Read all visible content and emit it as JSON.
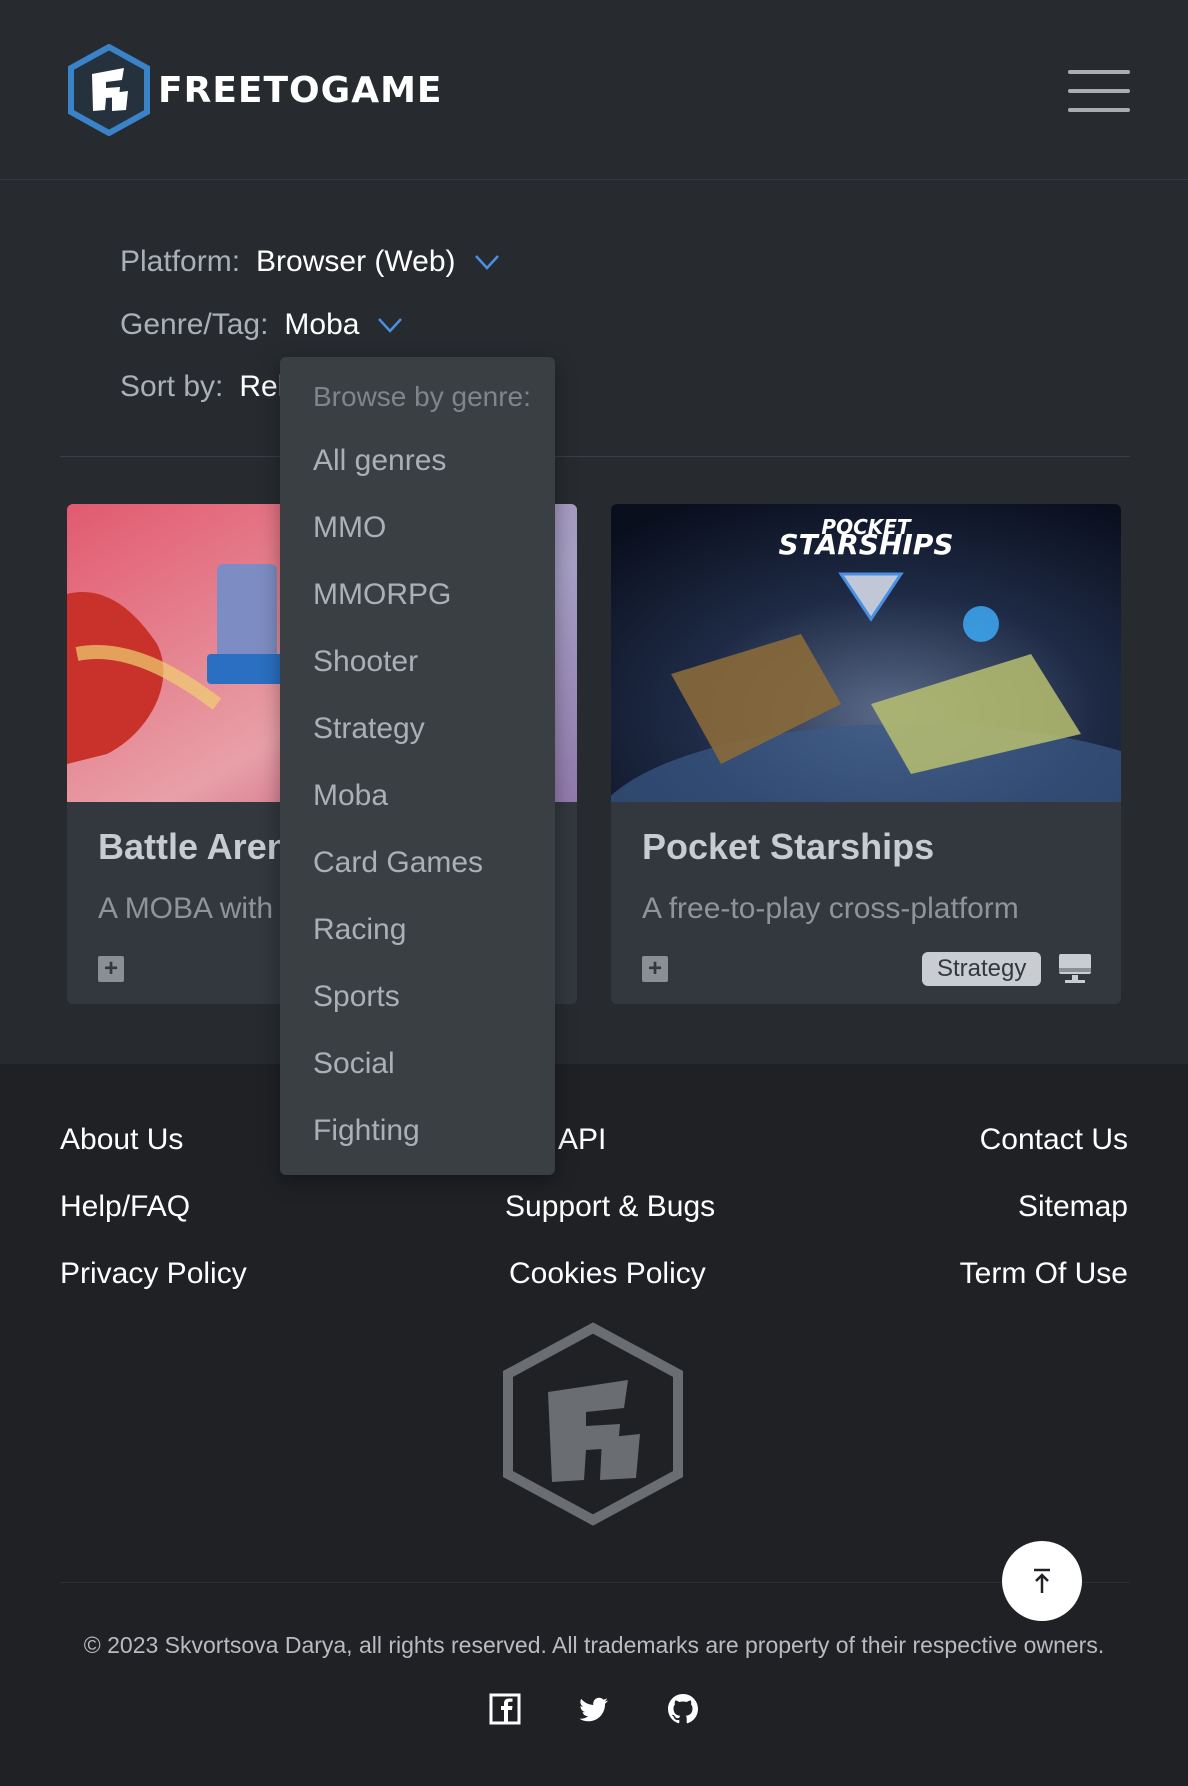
{
  "header": {
    "logo_text": "FREETOGAME",
    "menu_icon": "hamburger-menu-icon"
  },
  "filters": {
    "platform_label": "Platform:",
    "platform_value": "Browser (Web)",
    "genre_label": "Genre/Tag:",
    "genre_value": "Moba",
    "sort_label": "Sort by:",
    "sort_value": "Rel"
  },
  "dropdown": {
    "header": "Browse by genre:",
    "items": [
      "All genres",
      "MMO",
      "MMORPG",
      "Shooter",
      "Strategy",
      "Moba",
      "Card Games",
      "Racing",
      "Sports",
      "Social",
      "Fighting"
    ]
  },
  "cards": [
    {
      "title": "Battle Aren",
      "description": "A MOBA with",
      "add_label": "+"
    },
    {
      "title": "Pocket Starships",
      "description": "A free-to-play cross-platform",
      "add_label": "+",
      "genre": "Strategy",
      "thumb_text_1": "POCKET",
      "thumb_text_2": "STARSHIPS"
    }
  ],
  "footer": {
    "links": {
      "about": "About Us",
      "api": "API",
      "contact": "Contact Us",
      "help": "Help/FAQ",
      "support": "Support & Bugs",
      "sitemap": "Sitemap",
      "privacy": "Privacy Policy",
      "cookies": "Cookies Policy",
      "terms": "Term Of Use"
    },
    "copyright": "© 2023 Skvortsova Darya, all rights reserved. All trademarks are property of their respective owners.",
    "scroll_top_label": "⤒"
  },
  "colors": {
    "background": "#272b30",
    "card": "#32383e",
    "dropdown": "#3a3f44",
    "footer": "#1f2125",
    "accent": "#4a90e2"
  }
}
